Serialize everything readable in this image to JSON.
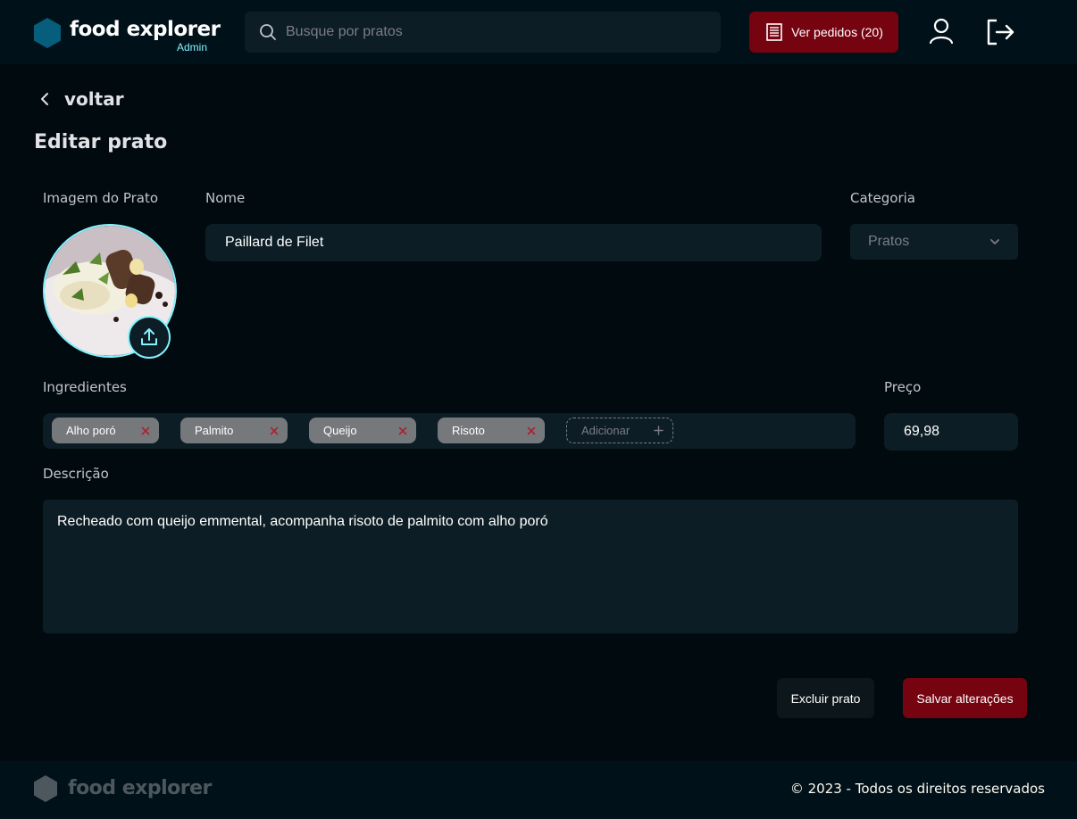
{
  "header": {
    "brand": "food explorer",
    "badge": "Admin",
    "search_placeholder": "Busque por pratos",
    "orders_label": "Ver pedidos (20)"
  },
  "nav": {
    "back_label": "voltar"
  },
  "page": {
    "title": "Editar prato"
  },
  "form": {
    "image_label": "Imagem do Prato",
    "name_label": "Nome",
    "name_value": "Paillard de Filet",
    "category_label": "Categoria",
    "category_value": "Pratos",
    "ingredients_label": "Ingredientes",
    "ingredients": [
      "Alho poró",
      "Palmito",
      "Queijo",
      "Risoto"
    ],
    "add_ingredient_placeholder": "Adicionar",
    "price_label": "Preço",
    "price_value": "69,98",
    "description_label": "Descrição",
    "description_value": "Recheado com queijo emmental, acompanha risoto de palmito com alho poró"
  },
  "actions": {
    "delete_label": "Excluir prato",
    "save_label": "Salvar alterações"
  },
  "footer": {
    "brand": "food explorer",
    "copyright": "© 2023 - Todos os direitos reservados"
  },
  "colors": {
    "accent": "#750310",
    "highlight": "#82f3ff",
    "brand_hex": "#065e7c"
  }
}
